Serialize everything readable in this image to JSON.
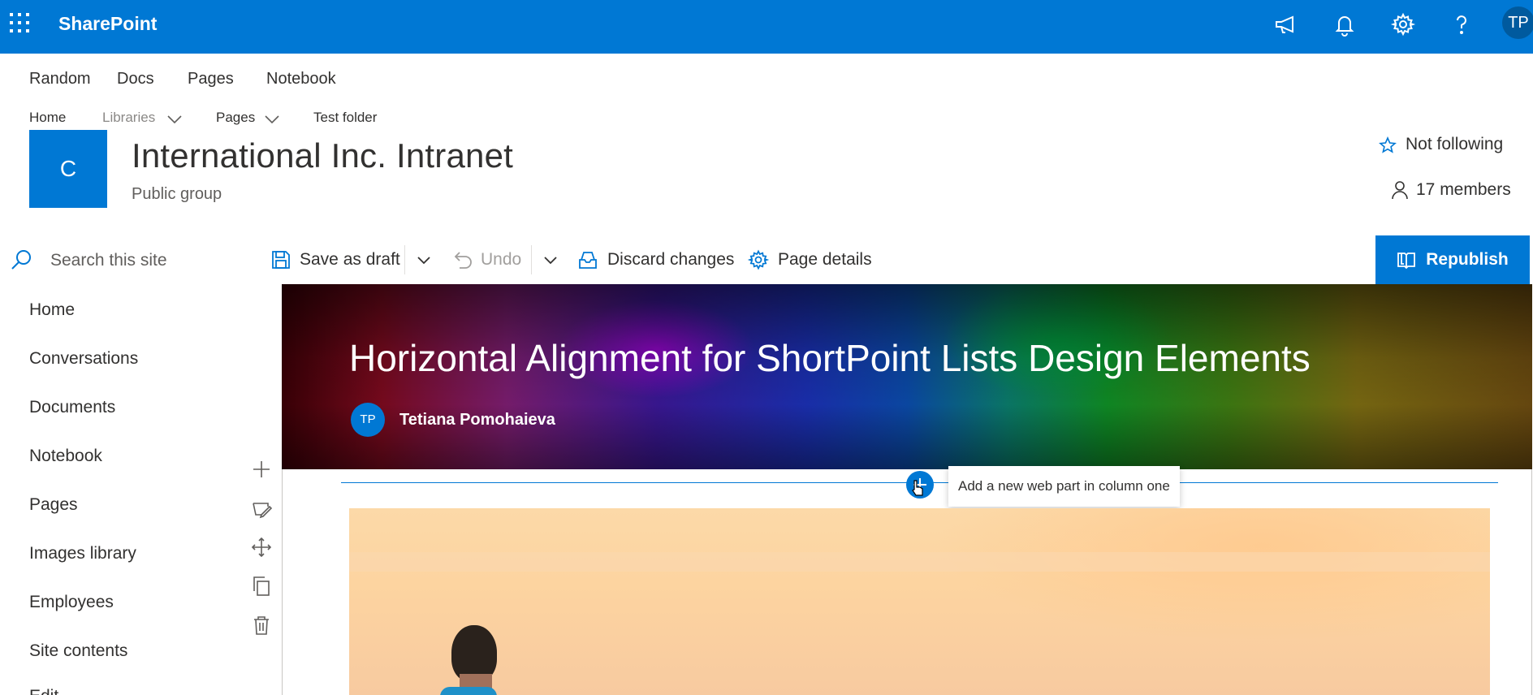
{
  "suite": {
    "brand": "SharePoint",
    "avatar_initials": "TP",
    "accent_color": "#0078d4",
    "icons": [
      "waffle-icon",
      "megaphone-icon",
      "bell-icon",
      "gear-icon",
      "help-icon"
    ]
  },
  "hub_nav": [
    "Random",
    "Docs",
    "Pages",
    "Notebook"
  ],
  "site_nav": {
    "home": "Home",
    "libraries": "Libraries",
    "pages": "Pages",
    "test_folder": "Test folder"
  },
  "site": {
    "logo_letter": "C",
    "title": "International Inc. Intranet",
    "subtitle": "Public group",
    "follow_label": "Not following",
    "members_label": "17 members"
  },
  "search": {
    "placeholder": "Search this site"
  },
  "left_nav": [
    "Home",
    "Conversations",
    "Documents",
    "Notebook",
    "Pages",
    "Images library",
    "Employees",
    "Site contents",
    "Edit"
  ],
  "command_bar": {
    "save_draft": "Save as draft",
    "undo": "Undo",
    "discard": "Discard changes",
    "page_details": "Page details",
    "republish": "Republish"
  },
  "page": {
    "title": "Horizontal Alignment for ShortPoint Lists Design Elements",
    "author_initials": "TP",
    "author_name": "Tetiana Pomohaieva",
    "add_tooltip": "Add a new web part in column one"
  }
}
